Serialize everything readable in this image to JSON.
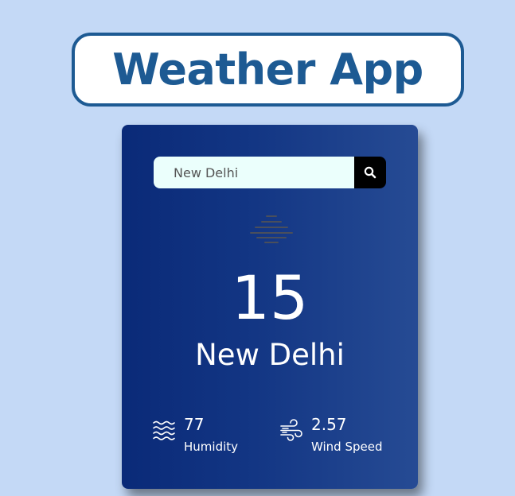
{
  "header": {
    "title": "Weather App"
  },
  "search": {
    "value": "New Delhi",
    "placeholder": "",
    "button_icon": "search-icon"
  },
  "weather": {
    "icon": "mist-icon",
    "temperature": "15",
    "city": "New Delhi"
  },
  "details": {
    "humidity": {
      "icon": "humidity-waves-icon",
      "value": "77",
      "label": "Humidity"
    },
    "wind": {
      "icon": "wind-icon",
      "value": "2.57",
      "label": "Wind Speed"
    }
  },
  "colors": {
    "page_background": "#c4d9f6",
    "title_color": "#1d5a93",
    "card_gradient_start": "#0a2a78",
    "card_gradient_end": "#264b94",
    "search_background": "#ebfffc",
    "search_button": "#000000",
    "text_on_card": "#ffffff"
  }
}
